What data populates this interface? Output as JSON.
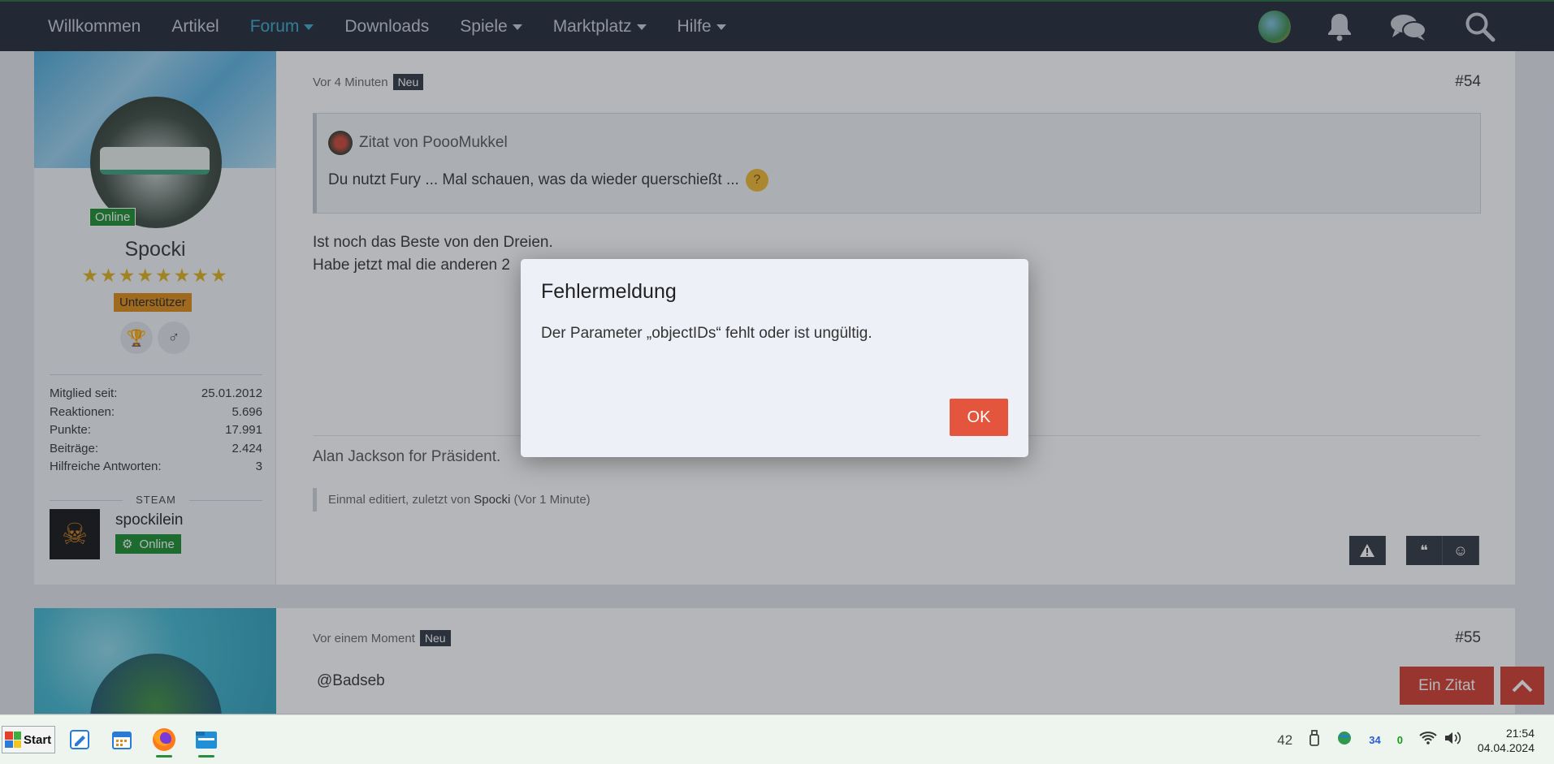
{
  "nav": {
    "items": [
      {
        "label": "Willkommen",
        "dropdown": false,
        "active": false
      },
      {
        "label": "Artikel",
        "dropdown": false,
        "active": false
      },
      {
        "label": "Forum",
        "dropdown": true,
        "active": true
      },
      {
        "label": "Downloads",
        "dropdown": false,
        "active": false
      },
      {
        "label": "Spiele",
        "dropdown": true,
        "active": false
      },
      {
        "label": "Marktplatz",
        "dropdown": true,
        "active": false
      },
      {
        "label": "Hilfe",
        "dropdown": true,
        "active": false
      }
    ],
    "icons": [
      "avatar",
      "bell-icon",
      "chat-icon",
      "search-icon"
    ]
  },
  "post1": {
    "time": "Vor 4 Minuten",
    "new_badge": "Neu",
    "number": "#54",
    "user": {
      "name": "Spocki",
      "status": "Online",
      "stars": "★★★★★★★★",
      "role": "Unterstützer",
      "stats": [
        {
          "label": "Mitglied seit:",
          "value": "25.01.2012"
        },
        {
          "label": "Reaktionen:",
          "value": "5.696"
        },
        {
          "label": "Punkte:",
          "value": "17.991"
        },
        {
          "label": "Beiträge:",
          "value": "2.424"
        },
        {
          "label": "Hilfreiche Antworten:",
          "value": "3"
        }
      ],
      "steam_heading": "STEAM",
      "steam_name": "spockilein",
      "steam_status": "Online"
    },
    "quote_author": "Zitat von PoooMukkel",
    "quote_text": "Du nutzt Fury ... Mal schauen, was da wieder querschießt ...",
    "body_line1": "Ist noch das Beste von den Dreien.",
    "body_line2": "Habe jetzt mal die anderen 2",
    "signature": "Alan Jackson for Präsident.",
    "edited_prefix": "Einmal editiert, zuletzt von",
    "edited_user": "Spocki",
    "edited_suffix": "(Vor 1 Minute)"
  },
  "post2": {
    "time": "Vor einem Moment",
    "new_badge": "Neu",
    "number": "#55",
    "mention": "@Badseb"
  },
  "floating": {
    "quote_button": "Ein Zitat"
  },
  "dialog": {
    "title": "Fehlermeldung",
    "message": "Der Parameter „objectIDs“ fehlt oder ist ungültig.",
    "ok_label": "OK"
  },
  "taskbar": {
    "start_label": "Start",
    "tray_number": "42",
    "tray_blue": "34",
    "tray_green": "0",
    "time": "21:54",
    "date": "04.04.2024"
  },
  "colors": {
    "nav_bg": "#1f2733",
    "nav_active": "#3aa9c9",
    "ok_button": "#e4553e",
    "online_green": "#1a8d2c",
    "role_orange": "#e08a12",
    "quote_red": "#d43a2c"
  }
}
